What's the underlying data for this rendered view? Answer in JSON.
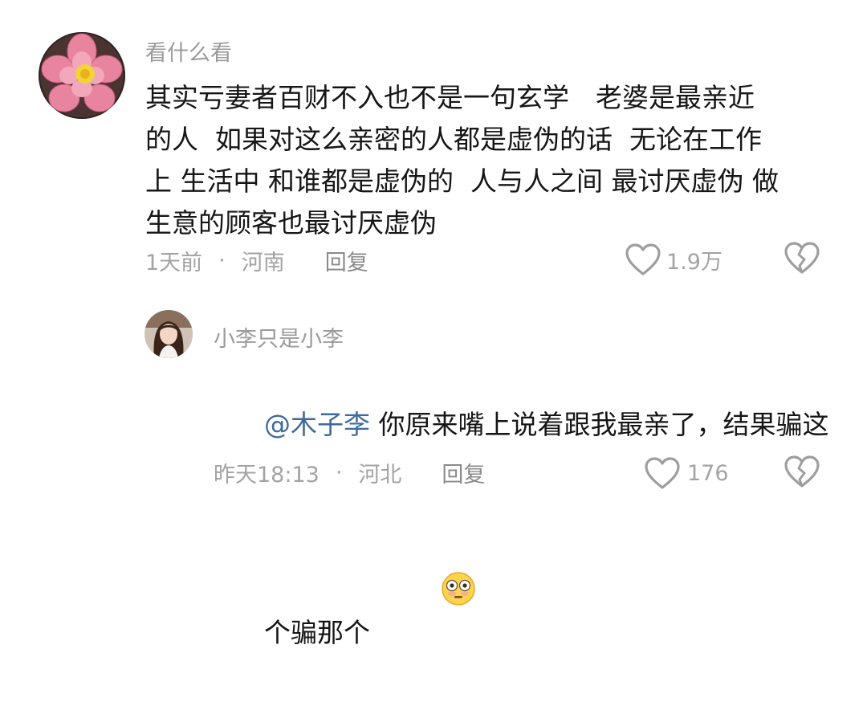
{
  "comments": [
    {
      "username": "看什么看",
      "text_lines": [
        "其实亏妻者百财不入也不是一句玄学　老婆是最亲近",
        "的人  如果对这么亲密的人都是虚伪的话  无论在工作",
        "上 生活中 和谁都是虚伪的  人与人之间 最讨厌虚伪 做",
        "生意的顾客也最讨厌虚伪"
      ],
      "time": "1天前",
      "separator": "·",
      "location": "河南",
      "reply_label": "回复",
      "like_count": "1.9万"
    }
  ],
  "reply": {
    "username": "小李只是小李",
    "mention": "@木子李",
    "text_line1": " 你原来嘴上说着跟我最亲了，结果骗这",
    "text_line2": "个骗那个",
    "time": "昨天18:13",
    "separator": "·",
    "location": "河北",
    "reply_label": "回复",
    "like_count": "176"
  },
  "icons": {
    "like": "heart-outline-icon",
    "dislike": "broken-heart-icon",
    "emoji": "flushed-face-emoji"
  },
  "colors": {
    "mention": "#3d6a9c",
    "meta": "#a3a3a3",
    "text": "#161616"
  }
}
